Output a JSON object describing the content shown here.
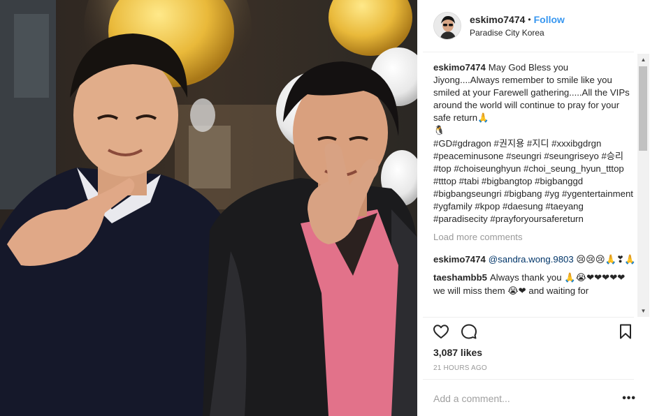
{
  "post": {
    "username": "eskimo7474",
    "dot": "•",
    "follow_label": "Follow",
    "location": "Paradise City Korea"
  },
  "caption": {
    "username": "eskimo7474",
    "text": "May God Bless you Jiyong....Always remember to smile like you smiled at your Farewell gathering.....All the VIPs around the world will continue to pray for your safe return🙏\n🐧\n#GD#gdragon #권지용 #지디 #xxxibgdrgn #peaceminusone #seungri #seungriseyo #승리 #top #choiseunghyun #choi_seung_hyun_tttop #tttop #tabi #bigbangtop #bigbanggd #bigbangseungri #bigbang #yg #ygentertainment #ygfamily #kpop #daesung #taeyang #paradisecity #prayforyoursafereturn"
  },
  "load_more_label": "Load more comments",
  "comments": [
    {
      "username": "eskimo7474",
      "mention": "@sandra.wong.9803",
      "text": " 😢😢😢🙏❣🙏"
    },
    {
      "username": "taeshambb5",
      "mention": "",
      "text": "Always thank you 🙏😭❤❤❤❤❤ we will miss them 😭❤ and waiting for"
    }
  ],
  "scrollbar": {
    "up": "▲",
    "down": "▼"
  },
  "actions": {
    "like": "heart-icon",
    "comment": "comment-icon",
    "save": "bookmark-icon"
  },
  "likes_text": "3,087 likes",
  "time_text": "21 HOURS AGO",
  "add_comment_placeholder": "Add a comment...",
  "more_options": "•••",
  "colors": {
    "link_blue": "#3897f0",
    "muted": "#999999",
    "text": "#262626"
  }
}
